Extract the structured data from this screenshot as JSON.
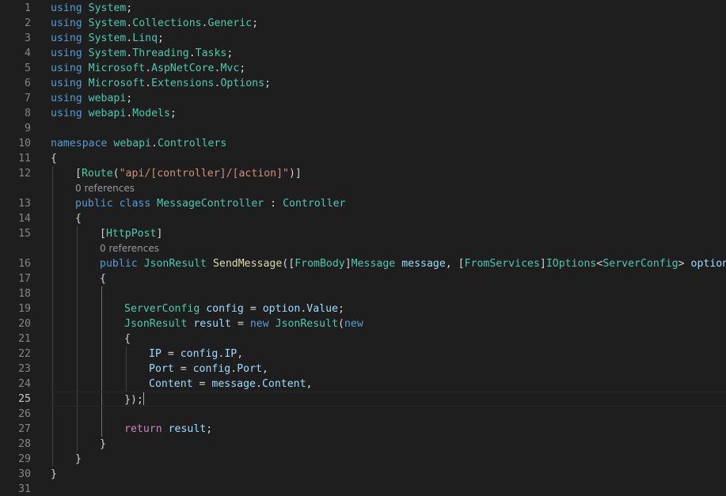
{
  "editor": {
    "language": "csharp",
    "current_line": 25,
    "lines": [
      {
        "n": "1",
        "indent": 0,
        "tokens": [
          [
            "k",
            "using"
          ],
          [
            "p",
            " "
          ],
          [
            "t",
            "System"
          ],
          [
            "p",
            ";"
          ]
        ]
      },
      {
        "n": "2",
        "indent": 0,
        "tokens": [
          [
            "k",
            "using"
          ],
          [
            "p",
            " "
          ],
          [
            "t",
            "System"
          ],
          [
            "p",
            "."
          ],
          [
            "t",
            "Collections"
          ],
          [
            "p",
            "."
          ],
          [
            "t",
            "Generic"
          ],
          [
            "p",
            ";"
          ]
        ]
      },
      {
        "n": "3",
        "indent": 0,
        "tokens": [
          [
            "k",
            "using"
          ],
          [
            "p",
            " "
          ],
          [
            "t",
            "System"
          ],
          [
            "p",
            "."
          ],
          [
            "t",
            "Linq"
          ],
          [
            "p",
            ";"
          ]
        ]
      },
      {
        "n": "4",
        "indent": 0,
        "tokens": [
          [
            "k",
            "using"
          ],
          [
            "p",
            " "
          ],
          [
            "t",
            "System"
          ],
          [
            "p",
            "."
          ],
          [
            "t",
            "Threading"
          ],
          [
            "p",
            "."
          ],
          [
            "t",
            "Tasks"
          ],
          [
            "p",
            ";"
          ]
        ]
      },
      {
        "n": "5",
        "indent": 0,
        "tokens": [
          [
            "k",
            "using"
          ],
          [
            "p",
            " "
          ],
          [
            "t",
            "Microsoft"
          ],
          [
            "p",
            "."
          ],
          [
            "t",
            "AspNetCore"
          ],
          [
            "p",
            "."
          ],
          [
            "t",
            "Mvc"
          ],
          [
            "p",
            ";"
          ]
        ]
      },
      {
        "n": "6",
        "indent": 0,
        "tokens": [
          [
            "k",
            "using"
          ],
          [
            "p",
            " "
          ],
          [
            "t",
            "Microsoft"
          ],
          [
            "p",
            "."
          ],
          [
            "t",
            "Extensions"
          ],
          [
            "p",
            "."
          ],
          [
            "t",
            "Options"
          ],
          [
            "p",
            ";"
          ]
        ]
      },
      {
        "n": "7",
        "indent": 0,
        "tokens": [
          [
            "k",
            "using"
          ],
          [
            "p",
            " "
          ],
          [
            "t",
            "webapi"
          ],
          [
            "p",
            ";"
          ]
        ]
      },
      {
        "n": "8",
        "indent": 0,
        "tokens": [
          [
            "k",
            "using"
          ],
          [
            "p",
            " "
          ],
          [
            "t",
            "webapi"
          ],
          [
            "p",
            "."
          ],
          [
            "t",
            "Models"
          ],
          [
            "p",
            ";"
          ]
        ]
      },
      {
        "n": "9",
        "indent": 0,
        "tokens": []
      },
      {
        "n": "10",
        "indent": 0,
        "tokens": [
          [
            "k",
            "namespace"
          ],
          [
            "p",
            " "
          ],
          [
            "t",
            "webapi"
          ],
          [
            "p",
            "."
          ],
          [
            "t",
            "Controllers"
          ]
        ]
      },
      {
        "n": "11",
        "indent": 0,
        "tokens": [
          [
            "p",
            "{"
          ]
        ]
      },
      {
        "n": "12",
        "indent": 1,
        "tokens": [
          [
            "p",
            "["
          ],
          [
            "t",
            "Route"
          ],
          [
            "p",
            "("
          ],
          [
            "s",
            "\"api/[controller]/[action]\""
          ],
          [
            "p",
            ")]"
          ]
        ]
      },
      {
        "n": "13",
        "indent": 1,
        "lens": "0 references",
        "tokens": [
          [
            "k",
            "public"
          ],
          [
            "p",
            " "
          ],
          [
            "k",
            "class"
          ],
          [
            "p",
            " "
          ],
          [
            "t",
            "MessageController"
          ],
          [
            "p",
            " : "
          ],
          [
            "t",
            "Controller"
          ]
        ]
      },
      {
        "n": "14",
        "indent": 1,
        "tokens": [
          [
            "p",
            "{"
          ]
        ]
      },
      {
        "n": "15",
        "indent": 2,
        "tokens": [
          [
            "p",
            "["
          ],
          [
            "t",
            "HttpPost"
          ],
          [
            "p",
            "]"
          ]
        ]
      },
      {
        "n": "16",
        "indent": 2,
        "lens": "0 references",
        "tokens": [
          [
            "k",
            "public"
          ],
          [
            "p",
            " "
          ],
          [
            "t",
            "JsonResult"
          ],
          [
            "p",
            " "
          ],
          [
            "m",
            "SendMessage"
          ],
          [
            "p",
            "(["
          ],
          [
            "t",
            "FromBody"
          ],
          [
            "p",
            "]"
          ],
          [
            "t",
            "Message"
          ],
          [
            "p",
            " "
          ],
          [
            "v",
            "message"
          ],
          [
            "p",
            ", ["
          ],
          [
            "t",
            "FromServices"
          ],
          [
            "p",
            "]"
          ],
          [
            "t",
            "IOptions"
          ],
          [
            "p",
            "<"
          ],
          [
            "t",
            "ServerConfig"
          ],
          [
            "p",
            "> "
          ],
          [
            "v",
            "option"
          ],
          [
            "p",
            ")"
          ]
        ]
      },
      {
        "n": "17",
        "indent": 2,
        "tokens": [
          [
            "p",
            "{"
          ]
        ]
      },
      {
        "n": "18",
        "indent": 3,
        "tokens": []
      },
      {
        "n": "19",
        "indent": 3,
        "tokens": [
          [
            "t",
            "ServerConfig"
          ],
          [
            "p",
            " "
          ],
          [
            "v",
            "config"
          ],
          [
            "p",
            " = "
          ],
          [
            "v",
            "option"
          ],
          [
            "p",
            "."
          ],
          [
            "v",
            "Value"
          ],
          [
            "p",
            ";"
          ]
        ]
      },
      {
        "n": "20",
        "indent": 3,
        "tokens": [
          [
            "t",
            "JsonResult"
          ],
          [
            "p",
            " "
          ],
          [
            "v",
            "result"
          ],
          [
            "p",
            " = "
          ],
          [
            "k",
            "new"
          ],
          [
            "p",
            " "
          ],
          [
            "t",
            "JsonResult"
          ],
          [
            "p",
            "("
          ],
          [
            "k",
            "new"
          ]
        ]
      },
      {
        "n": "21",
        "indent": 3,
        "tokens": [
          [
            "p",
            "{"
          ]
        ]
      },
      {
        "n": "22",
        "indent": 4,
        "tokens": [
          [
            "v",
            "IP"
          ],
          [
            "p",
            " = "
          ],
          [
            "v",
            "config"
          ],
          [
            "p",
            "."
          ],
          [
            "v",
            "IP"
          ],
          [
            "p",
            ","
          ]
        ]
      },
      {
        "n": "23",
        "indent": 4,
        "tokens": [
          [
            "v",
            "Port"
          ],
          [
            "p",
            " = "
          ],
          [
            "v",
            "config"
          ],
          [
            "p",
            "."
          ],
          [
            "v",
            "Port"
          ],
          [
            "p",
            ","
          ]
        ]
      },
      {
        "n": "24",
        "indent": 4,
        "tokens": [
          [
            "v",
            "Content"
          ],
          [
            "p",
            " = "
          ],
          [
            "v",
            "message"
          ],
          [
            "p",
            "."
          ],
          [
            "v",
            "Content"
          ],
          [
            "p",
            ","
          ]
        ]
      },
      {
        "n": "25",
        "indent": 3,
        "cursor": true,
        "tokens": [
          [
            "p",
            "});"
          ]
        ]
      },
      {
        "n": "26",
        "indent": 3,
        "tokens": []
      },
      {
        "n": "27",
        "indent": 3,
        "tokens": [
          [
            "c",
            "return"
          ],
          [
            "p",
            " "
          ],
          [
            "v",
            "result"
          ],
          [
            "p",
            ";"
          ]
        ]
      },
      {
        "n": "28",
        "indent": 2,
        "tokens": [
          [
            "p",
            "}"
          ]
        ]
      },
      {
        "n": "29",
        "indent": 1,
        "tokens": [
          [
            "p",
            "}"
          ]
        ]
      },
      {
        "n": "30",
        "indent": 0,
        "tokens": [
          [
            "p",
            "}"
          ]
        ]
      },
      {
        "n": "31",
        "indent": 0,
        "tokens": []
      }
    ]
  }
}
